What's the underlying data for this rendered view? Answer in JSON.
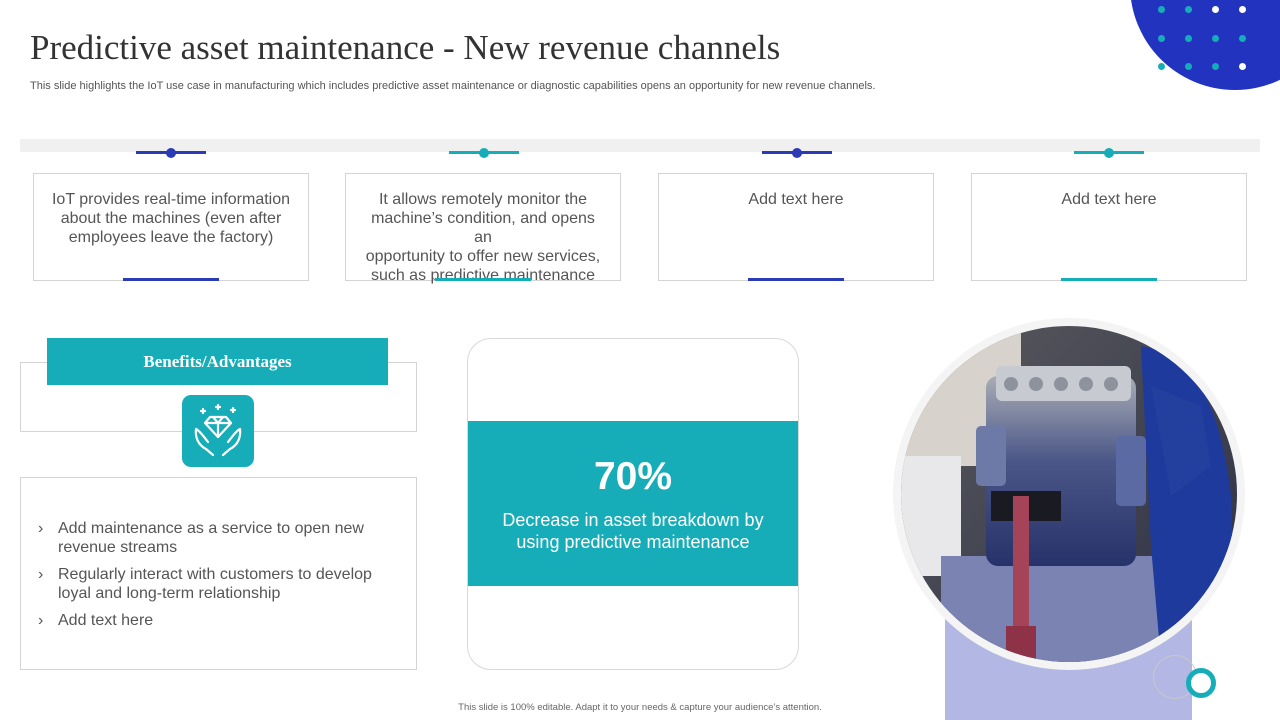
{
  "slide": {
    "title": "Predictive asset maintenance - New revenue channels",
    "subtitle": "This slide highlights the IoT use case in manufacturing which includes predictive asset maintenance or diagnostic capabilities opens an opportunity for new revenue channels.",
    "footer": "This slide is 100% editable. Adapt it to your needs & capture your audience’s attention."
  },
  "colors": {
    "accent_blue": "#2a3bb5",
    "accent_teal": "#16adb9",
    "lavender": "#b3b7e3"
  },
  "cards": [
    {
      "lines": [
        "IoT provides real-time information",
        "about the machines (even after",
        "employees leave the factory)"
      ],
      "accent": "blue"
    },
    {
      "lines": [
        "It allows remotely monitor the",
        "machine’s condition, and opens an",
        "opportunity to offer new services,",
        "such as predictive maintenance"
      ],
      "accent": "teal"
    },
    {
      "lines": [
        "Add text here"
      ],
      "accent": "blue"
    },
    {
      "lines": [
        "Add text here"
      ],
      "accent": "teal"
    }
  ],
  "benefits": {
    "heading": "Benefits/Advantages",
    "icon": "diamond-hands-icon",
    "items": [
      {
        "lines": [
          "Add maintenance as a service to open new",
          "revenue streams"
        ]
      },
      {
        "lines": [
          "Regularly interact with customers to develop",
          "loyal and long-term relationship"
        ]
      },
      {
        "lines": [
          "Add text here"
        ]
      }
    ]
  },
  "stat": {
    "value": "70%",
    "description_lines": [
      "Decrease in asset breakdown by",
      "using predictive maintenance"
    ]
  },
  "photo": {
    "subject": "engine-on-stand-photo"
  }
}
